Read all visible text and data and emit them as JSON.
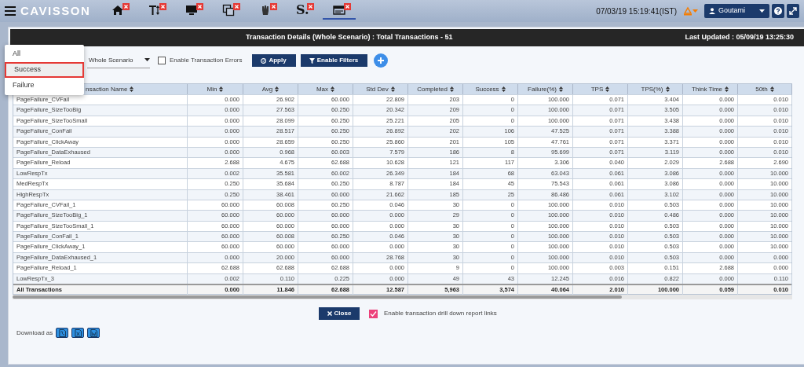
{
  "app_bar": {
    "logo": "CAVISSON",
    "tabs": [
      {
        "kind": "home",
        "selected": false
      },
      {
        "kind": "text",
        "selected": false
      },
      {
        "kind": "monitor",
        "selected": false
      },
      {
        "kind": "windows",
        "selected": false
      },
      {
        "kind": "hand",
        "selected": false
      },
      {
        "kind": "s-logo",
        "label": "S.",
        "selected": false
      },
      {
        "kind": "panel",
        "selected": true
      }
    ],
    "datetime": "07/03/19 15:19:41(IST)",
    "user": "Goutami"
  },
  "dialog": {
    "title": "Transaction Details (Whole Scenario) : Total Transactions - 51",
    "last_updated": "Last Updated : 05/09/19 13:25:30",
    "scope_select": {
      "value": "Whole Scenario"
    },
    "enable_errors": {
      "label": "Enable Transaction Errors",
      "checked": false
    },
    "buttons": {
      "apply": "Apply",
      "filters": "Enable Filters"
    },
    "status_menu": [
      {
        "label": "All",
        "selected": false
      },
      {
        "label": "Success",
        "selected": true
      },
      {
        "label": "Failure",
        "selected": false
      }
    ],
    "table": {
      "columns": [
        "nsaction Name",
        "Min",
        "Avg",
        "Max",
        "Std Dev",
        "Completed",
        "Success",
        "Failure(%)",
        "TPS",
        "TPS(%)",
        "Think Time",
        "50th"
      ],
      "rows": [
        [
          "PageFailure_CVFail",
          "0.000",
          "26.902",
          "60.000",
          "22.809",
          "203",
          "0",
          "100.000",
          "0.071",
          "3.404",
          "0.000",
          "0.010"
        ],
        [
          "PageFailure_SizeTooBig",
          "0.000",
          "27.563",
          "60.250",
          "20.342",
          "209",
          "0",
          "100.000",
          "0.071",
          "3.505",
          "0.000",
          "0.010"
        ],
        [
          "PageFailure_SizeTooSmall",
          "0.000",
          "28.099",
          "60.250",
          "25.221",
          "205",
          "0",
          "100.000",
          "0.071",
          "3.438",
          "0.000",
          "0.010"
        ],
        [
          "PageFailure_ConFail",
          "0.000",
          "28.517",
          "60.250",
          "26.892",
          "202",
          "106",
          "47.525",
          "0.071",
          "3.388",
          "0.000",
          "0.010"
        ],
        [
          "PageFailure_ClickAway",
          "0.000",
          "28.659",
          "60.250",
          "25.860",
          "201",
          "105",
          "47.761",
          "0.071",
          "3.371",
          "0.000",
          "0.010"
        ],
        [
          "PageFailure_DataExhaused",
          "0.000",
          "0.968",
          "60.003",
          "7.579",
          "186",
          "8",
          "95.699",
          "0.071",
          "3.119",
          "0.000",
          "0.010"
        ],
        [
          "PageFailure_Reload",
          "2.688",
          "4.675",
          "62.688",
          "10.628",
          "121",
          "117",
          "3.306",
          "0.040",
          "2.029",
          "2.688",
          "2.690"
        ],
        [
          "LowRespTx",
          "0.002",
          "35.581",
          "60.002",
          "26.349",
          "184",
          "68",
          "63.043",
          "0.061",
          "3.086",
          "0.000",
          "10.000"
        ],
        [
          "MedRespTx",
          "0.250",
          "35.684",
          "60.250",
          "8.787",
          "184",
          "45",
          "75.543",
          "0.061",
          "3.086",
          "0.000",
          "10.000"
        ],
        [
          "HighRespTx",
          "0.250",
          "38.461",
          "60.000",
          "21.662",
          "185",
          "25",
          "86.486",
          "0.061",
          "3.102",
          "0.000",
          "10.000"
        ],
        [
          "PageFailure_CVFail_1",
          "60.000",
          "60.008",
          "60.250",
          "0.046",
          "30",
          "0",
          "100.000",
          "0.010",
          "0.503",
          "0.000",
          "10.000"
        ],
        [
          "PageFailure_SizeTooBig_1",
          "60.000",
          "60.000",
          "60.000",
          "0.000",
          "29",
          "0",
          "100.000",
          "0.010",
          "0.486",
          "0.000",
          "10.000"
        ],
        [
          "PageFailure_SizeTooSmall_1",
          "60.000",
          "60.000",
          "60.000",
          "0.000",
          "30",
          "0",
          "100.000",
          "0.010",
          "0.503",
          "0.000",
          "10.000"
        ],
        [
          "PageFailure_ConFail_1",
          "60.000",
          "60.008",
          "60.250",
          "0.046",
          "30",
          "0",
          "100.000",
          "0.010",
          "0.503",
          "0.000",
          "10.000"
        ],
        [
          "PageFailure_ClickAway_1",
          "60.000",
          "60.000",
          "60.000",
          "0.000",
          "30",
          "0",
          "100.000",
          "0.010",
          "0.503",
          "0.000",
          "10.000"
        ],
        [
          "PageFailure_DataExhaused_1",
          "0.000",
          "20.000",
          "60.000",
          "28.768",
          "30",
          "0",
          "100.000",
          "0.010",
          "0.503",
          "0.000",
          "0.000"
        ],
        [
          "PageFailure_Reload_1",
          "62.688",
          "62.688",
          "62.688",
          "0.000",
          "9",
          "0",
          "100.000",
          "0.003",
          "0.151",
          "2.688",
          "0.000"
        ],
        [
          "LowRespTx_3",
          "0.002",
          "0.110",
          "0.225",
          "0.000",
          "49",
          "43",
          "12.245",
          "0.016",
          "0.822",
          "0.000",
          "0.110"
        ]
      ],
      "total": [
        "All Transactions",
        "0.000",
        "11.846",
        "62.688",
        "12.587",
        "5,963",
        "3,574",
        "40.064",
        "2.010",
        "100.000",
        "0.059",
        "0.010"
      ]
    },
    "close_button": "Close",
    "drill_down": {
      "label": "Enable transaction drill down report links",
      "checked": true
    },
    "download": {
      "label": "Download as",
      "formats": [
        {
          "kind": "pdf"
        },
        {
          "kind": "excel"
        },
        {
          "kind": "word"
        }
      ]
    }
  }
}
